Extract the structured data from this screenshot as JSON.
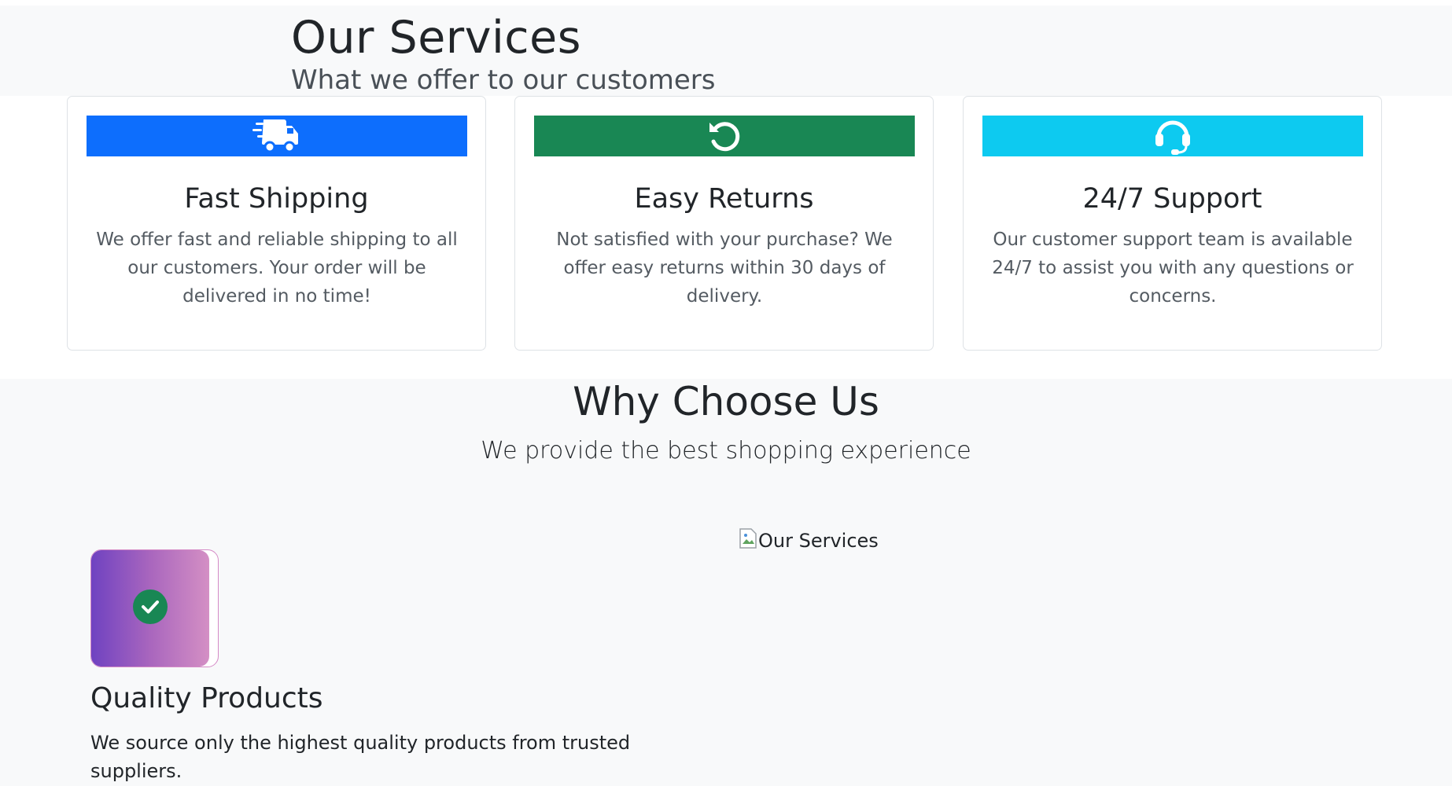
{
  "services": {
    "title": "Our Services",
    "subtitle": "What we offer to our customers",
    "cards": [
      {
        "icon": "truck-fast-icon",
        "banner_color": "#0d6efd",
        "title": "Fast Shipping",
        "text": "We offer fast and reliable shipping to all our customers. Your order will be delivered in no time!"
      },
      {
        "icon": "undo-icon",
        "banner_color": "#198754",
        "title": "Easy Returns",
        "text": "Not satisfied with your purchase? We offer easy returns within 30 days of delivery."
      },
      {
        "icon": "headset-icon",
        "banner_color": "#0dcaf0",
        "title": "24/7 Support",
        "text": "Our customer support team is available 24/7 to assist you with any questions or concerns."
      }
    ]
  },
  "why": {
    "title": "Why Choose Us",
    "subtitle": "We provide the best shopping experience",
    "feature": {
      "icon": "check-circle-icon",
      "title": "Quality Products",
      "text": "We source only the highest quality products from trusted suppliers."
    },
    "image_alt": "Our Services"
  }
}
